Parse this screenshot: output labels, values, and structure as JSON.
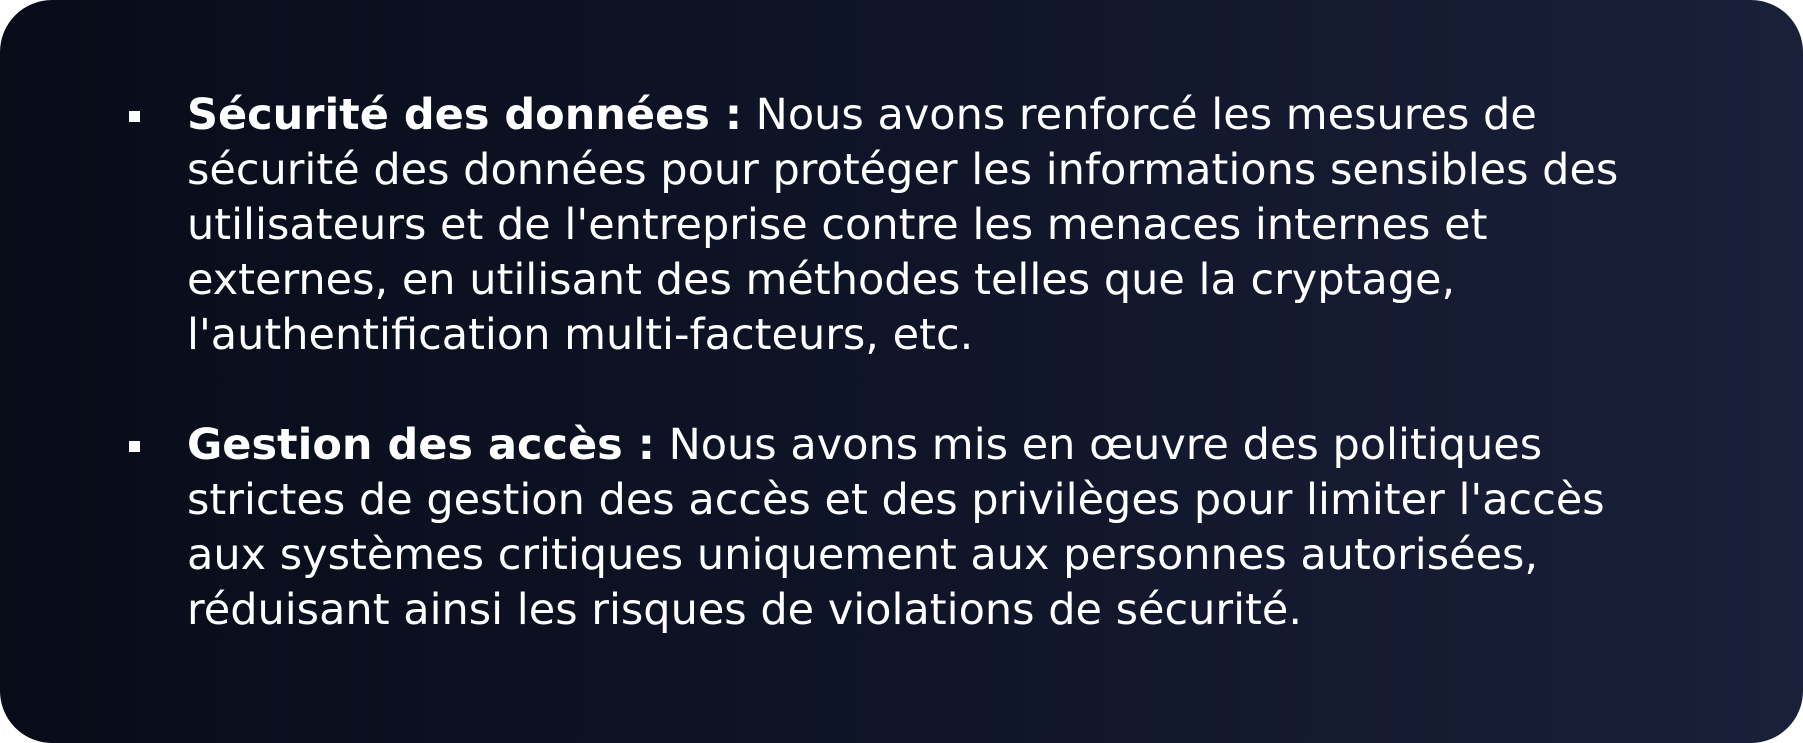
{
  "items": [
    {
      "title": "Sécurité des données :",
      "lines": [
        " Nous avons renforcé les mesures de",
        "sécurité des données pour protéger les informations sensibles des",
        "utilisateurs et de l'entreprise contre les menaces internes et",
        "externes, en utilisant des méthodes telles que la cryptage,",
        "l'authentification multi-facteurs, etc."
      ]
    },
    {
      "title": "Gestion des accès :",
      "lines": [
        " Nous avons mis en œuvre des politiques",
        "strictes de gestion des accès et des privilèges pour limiter l'accès",
        "aux systèmes critiques uniquement aux personnes autorisées,",
        "réduisant ainsi les risques de violations de sécurité."
      ]
    }
  ],
  "colors": {
    "background_start": "#080c19",
    "background_end": "#1a2039",
    "text": "#ffffff"
  }
}
